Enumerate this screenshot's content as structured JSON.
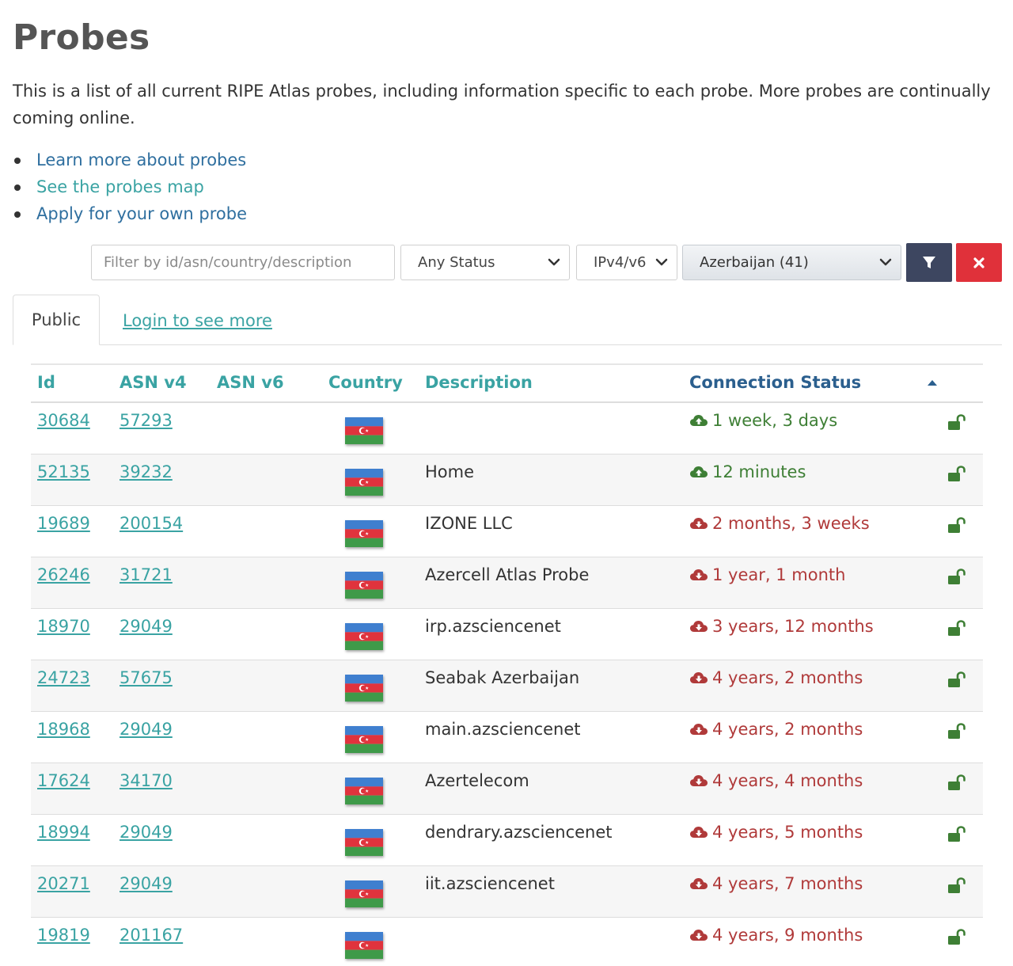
{
  "page": {
    "title": "Probes",
    "intro": "This is a list of all current RIPE Atlas probes, including information specific to each probe. More probes are continually coming online.",
    "links": [
      {
        "label": "Learn more about probes"
      },
      {
        "label": "See the probes map"
      },
      {
        "label": "Apply for your own probe"
      }
    ]
  },
  "filters": {
    "search_placeholder": "Filter by id/asn/country/description",
    "search_value": "",
    "status_selected": "Any Status",
    "ip_selected": "IPv4/v6",
    "country_selected": "Azerbaijan (41)",
    "filter_button_icon": "filter-icon",
    "clear_button_icon": "close-icon"
  },
  "tabs": [
    {
      "label": "Public",
      "active": true
    },
    {
      "label": "Login to see more",
      "active": false
    }
  ],
  "table": {
    "columns": {
      "id": "Id",
      "asn4": "ASN v4",
      "asn6": "ASN v6",
      "country": "Country",
      "description": "Description",
      "status": "Connection Status"
    },
    "sort": {
      "column": "Connection Status",
      "direction": "ascending"
    },
    "rows": [
      {
        "id": "30684",
        "asn4": "57293",
        "asn6": "",
        "country": "AZ",
        "description": "",
        "status": "1 week, 3 days",
        "connected": true
      },
      {
        "id": "52135",
        "asn4": "39232",
        "asn6": "",
        "country": "AZ",
        "description": "Home",
        "status": "12 minutes",
        "connected": true
      },
      {
        "id": "19689",
        "asn4": "200154",
        "asn6": "",
        "country": "AZ",
        "description": "IZONE LLC",
        "status": "2 months, 3 weeks",
        "connected": false
      },
      {
        "id": "26246",
        "asn4": "31721",
        "asn6": "",
        "country": "AZ",
        "description": "Azercell Atlas Probe",
        "status": "1 year, 1 month",
        "connected": false
      },
      {
        "id": "18970",
        "asn4": "29049",
        "asn6": "",
        "country": "AZ",
        "description": "irp.azsciencenet",
        "status": "3 years, 12 months",
        "connected": false
      },
      {
        "id": "24723",
        "asn4": "57675",
        "asn6": "",
        "country": "AZ",
        "description": "Seabak Azerbaijan",
        "status": "4 years, 2 months",
        "connected": false
      },
      {
        "id": "18968",
        "asn4": "29049",
        "asn6": "",
        "country": "AZ",
        "description": "main.azsciencenet",
        "status": "4 years, 2 months",
        "connected": false
      },
      {
        "id": "17624",
        "asn4": "34170",
        "asn6": "",
        "country": "AZ",
        "description": "Azertelecom",
        "status": "4 years, 4 months",
        "connected": false
      },
      {
        "id": "18994",
        "asn4": "29049",
        "asn6": "",
        "country": "AZ",
        "description": "dendrary.azsciencenet",
        "status": "4 years, 5 months",
        "connected": false
      },
      {
        "id": "20271",
        "asn4": "29049",
        "asn6": "",
        "country": "AZ",
        "description": "iit.azsciencenet",
        "status": "4 years, 7 months",
        "connected": false
      },
      {
        "id": "19819",
        "asn4": "201167",
        "asn6": "",
        "country": "AZ",
        "description": "",
        "status": "4 years, 9 months",
        "connected": false
      }
    ]
  },
  "colors": {
    "link": "#3aa3a3",
    "connected": "#3e7f35",
    "disconnected": "#b03a3a",
    "filter_button": "#3d4660",
    "clear_button": "#e0313a",
    "flag_blue": "#3f7fcf",
    "flag_red": "#e0333d",
    "flag_green": "#3f9a49"
  }
}
